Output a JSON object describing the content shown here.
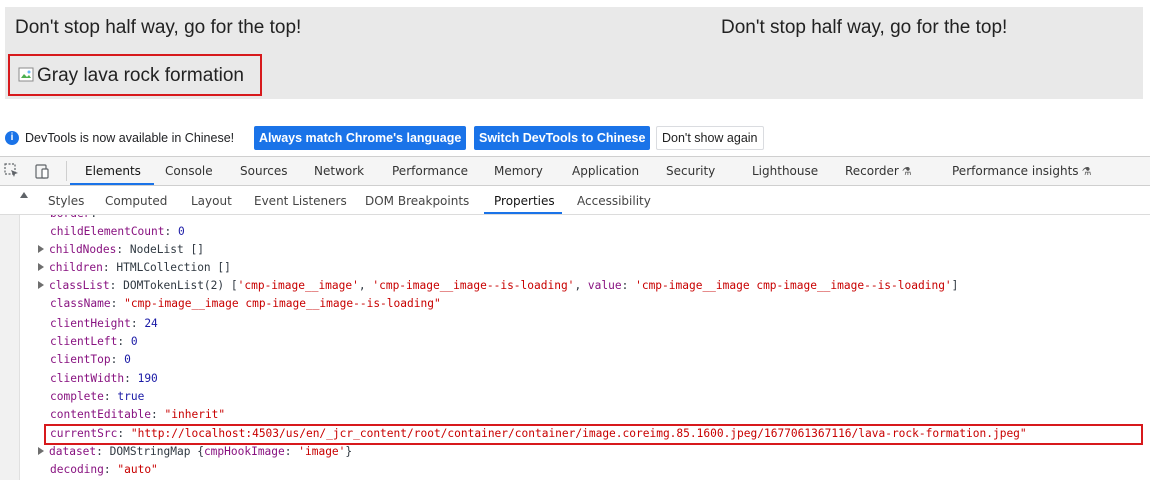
{
  "page": {
    "headline_left": "Don't stop half way, go for the top!",
    "headline_right": "Don't stop half way, go for the top!",
    "image_alt": "Gray lava rock formation"
  },
  "infobar": {
    "message": "DevTools is now available in Chinese!",
    "btn_match": "Always match Chrome's language",
    "btn_switch": "Switch DevTools to Chinese",
    "btn_dont": "Don't show again"
  },
  "main_tabs": [
    "Elements",
    "Console",
    "Sources",
    "Network",
    "Performance",
    "Memory",
    "Application",
    "Security",
    "Lighthouse",
    "Recorder",
    "Performance insights"
  ],
  "active_main_tab": "Elements",
  "sub_tabs": [
    "Styles",
    "Computed",
    "Layout",
    "Event Listeners",
    "DOM Breakpoints",
    "Properties",
    "Accessibility"
  ],
  "active_sub_tab": "Properties",
  "properties": {
    "border": {
      "key": "border",
      "sep": ": "
    },
    "childElementCount": {
      "key": "childElementCount",
      "sep": ": ",
      "value": "0"
    },
    "childNodes": {
      "key": "childNodes",
      "sep": ": ",
      "value": "NodeList []"
    },
    "children": {
      "key": "children",
      "sep": ": ",
      "value": "HTMLCollection []"
    },
    "classList": {
      "key": "classList",
      "sep": ": ",
      "prefix": "DOMTokenList(2) [",
      "item1": "'cmp-image__image'",
      "comma1": ", ",
      "item2": "'cmp-image__image--is-loading'",
      "comma2": ", ",
      "value_key": "value",
      "value_sep": ": ",
      "value_str": "'cmp-image__image cmp-image__image--is-loading'",
      "suffix": "]"
    },
    "className": {
      "key": "className",
      "sep": ": ",
      "value": "\"cmp-image__image cmp-image__image--is-loading\""
    },
    "clientHeight": {
      "key": "clientHeight",
      "sep": ": ",
      "value": "24"
    },
    "clientLeft": {
      "key": "clientLeft",
      "sep": ": ",
      "value": "0"
    },
    "clientTop": {
      "key": "clientTop",
      "sep": ": ",
      "value": "0"
    },
    "clientWidth": {
      "key": "clientWidth",
      "sep": ": ",
      "value": "190"
    },
    "complete": {
      "key": "complete",
      "sep": ": ",
      "value": "true"
    },
    "contentEditable": {
      "key": "contentEditable",
      "sep": ": ",
      "value": "\"inherit\""
    },
    "currentSrc": {
      "key": "currentSrc",
      "sep": ": ",
      "value": "\"http://localhost:4503/us/en/_jcr_content/root/container/container/image.coreimg.85.1600.jpeg/1677061367116/lava-rock-formation.jpeg\""
    },
    "dataset": {
      "key": "dataset",
      "sep": ": ",
      "prefix": "DOMStringMap {",
      "inner_key": "cmpHookImage",
      "inner_sep": ": ",
      "inner_value": "'image'",
      "suffix": "}"
    },
    "decoding": {
      "key": "decoding",
      "sep": ": ",
      "value": "\"auto\""
    }
  },
  "colors": {
    "accent": "#1a73e8",
    "highlight": "#d7191c",
    "property_key": "#881280",
    "string_value": "#c80000",
    "number_value": "#1a1aa6"
  },
  "icons": {
    "info": "info-icon",
    "inspect": "inspect-element-icon",
    "device": "device-toggle-icon",
    "flask": "experiment-flask-icon",
    "broken_image": "broken-image-icon"
  }
}
